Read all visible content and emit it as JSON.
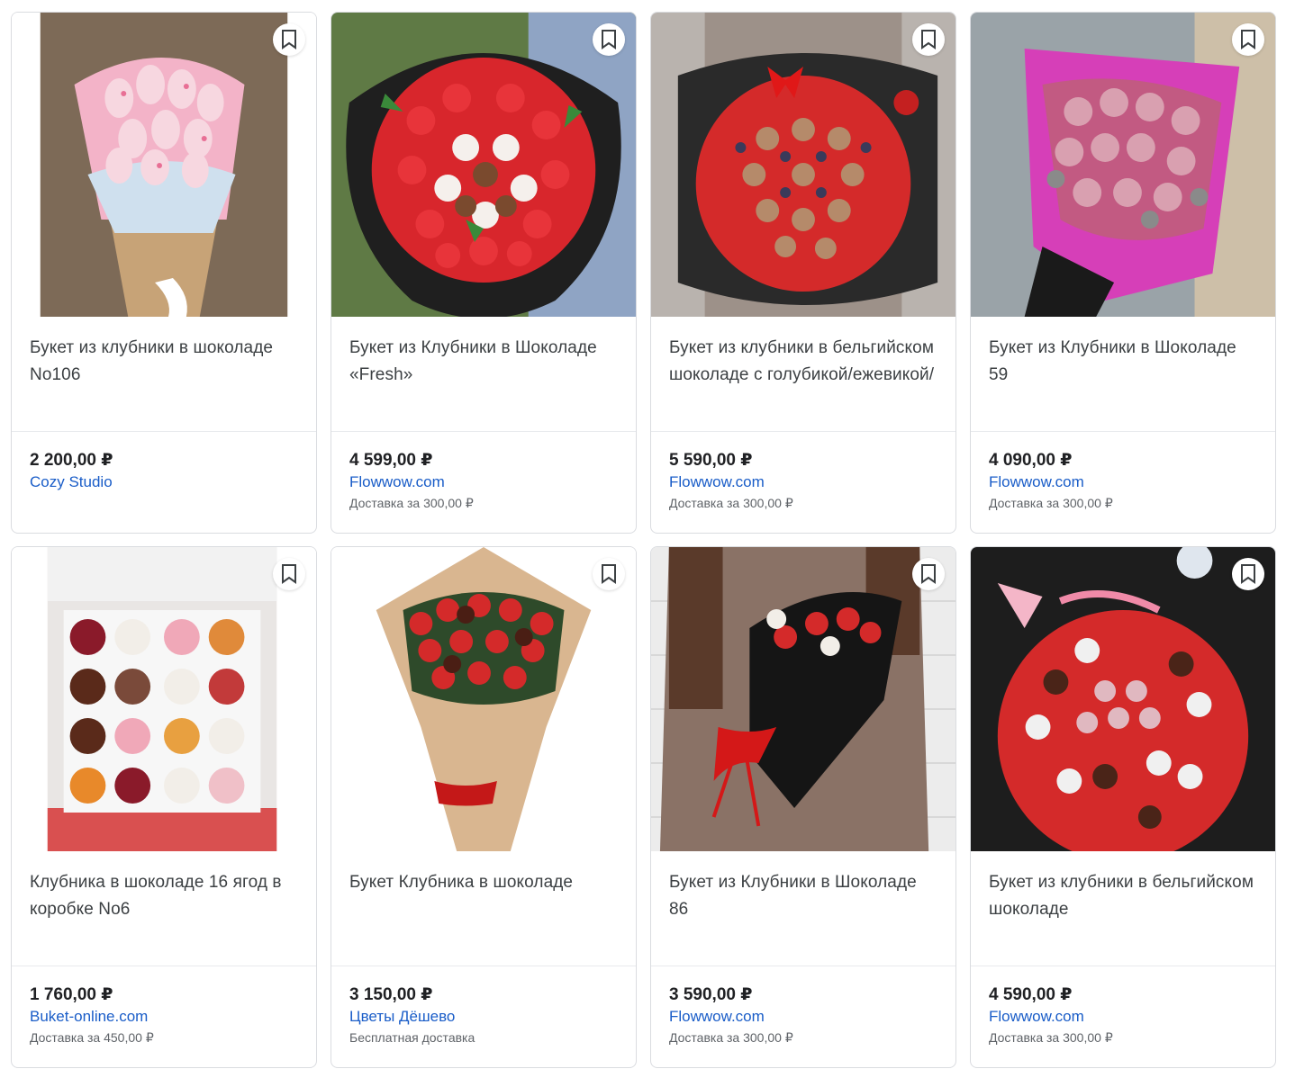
{
  "products": [
    {
      "title": "Букет из клубники в шоколаде No106",
      "price": "2 200,00 ₽",
      "merchant": "Cozy Studio",
      "delivery": ""
    },
    {
      "title": "Букет из Клубники в Шоколаде «Fresh»",
      "price": "4 599,00 ₽",
      "merchant": "Flowwow.com",
      "delivery": "Доставка за 300,00 ₽"
    },
    {
      "title": "Букет из клубники в бельгийском шоколаде с голубикой/ежевикой/",
      "price": "5 590,00 ₽",
      "merchant": "Flowwow.com",
      "delivery": "Доставка за 300,00 ₽"
    },
    {
      "title": "Букет из Клубники в Шоколаде 59",
      "price": "4 090,00 ₽",
      "merchant": "Flowwow.com",
      "delivery": "Доставка за 300,00 ₽"
    },
    {
      "title": "Клубника в шоколаде 16 ягод в коробке No6",
      "price": "1 760,00 ₽",
      "merchant": "Buket-online.com",
      "delivery": "Доставка за 450,00 ₽"
    },
    {
      "title": "Букет Клубника в шоколаде",
      "price": "3 150,00 ₽",
      "merchant": "Цветы Дёшево",
      "delivery": "Бесплатная доставка"
    },
    {
      "title": "Букет из Клубники в Шоколаде 86",
      "price": "3 590,00 ₽",
      "merchant": "Flowwow.com",
      "delivery": "Доставка за 300,00 ₽"
    },
    {
      "title": "Букет из клубники в бельгийском шоколаде",
      "price": "4 590,00 ₽",
      "merchant": "Flowwow.com",
      "delivery": "Доставка за 300,00 ₽"
    }
  ],
  "icons": {
    "bookmark": "bookmark-icon"
  },
  "colors": {
    "merchant_link": "#1a5dc8",
    "price": "#202124",
    "border": "#dadce0"
  }
}
